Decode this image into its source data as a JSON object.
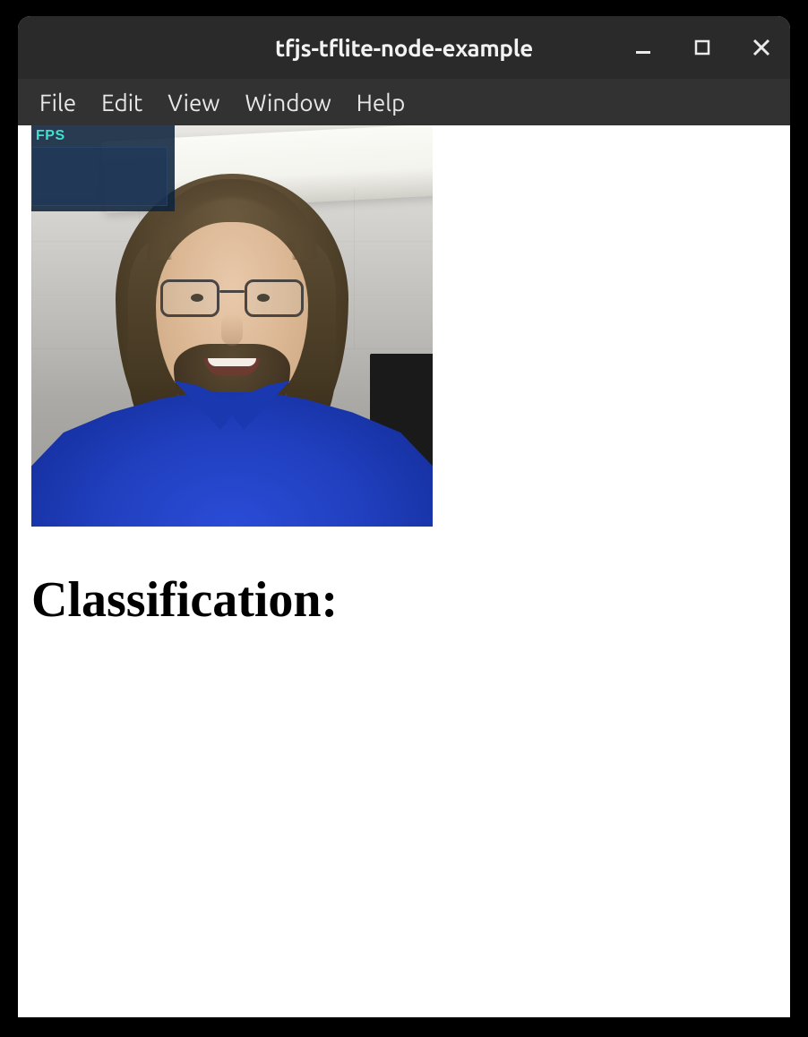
{
  "window": {
    "title": "tfjs-tflite-node-example"
  },
  "menubar": {
    "items": [
      "File",
      "Edit",
      "View",
      "Window",
      "Help"
    ]
  },
  "fps_overlay": {
    "label": "FPS"
  },
  "content": {
    "heading": "Classification:"
  },
  "icons": {
    "minimize": "minimize-icon",
    "maximize": "maximize-icon",
    "close": "close-icon"
  }
}
